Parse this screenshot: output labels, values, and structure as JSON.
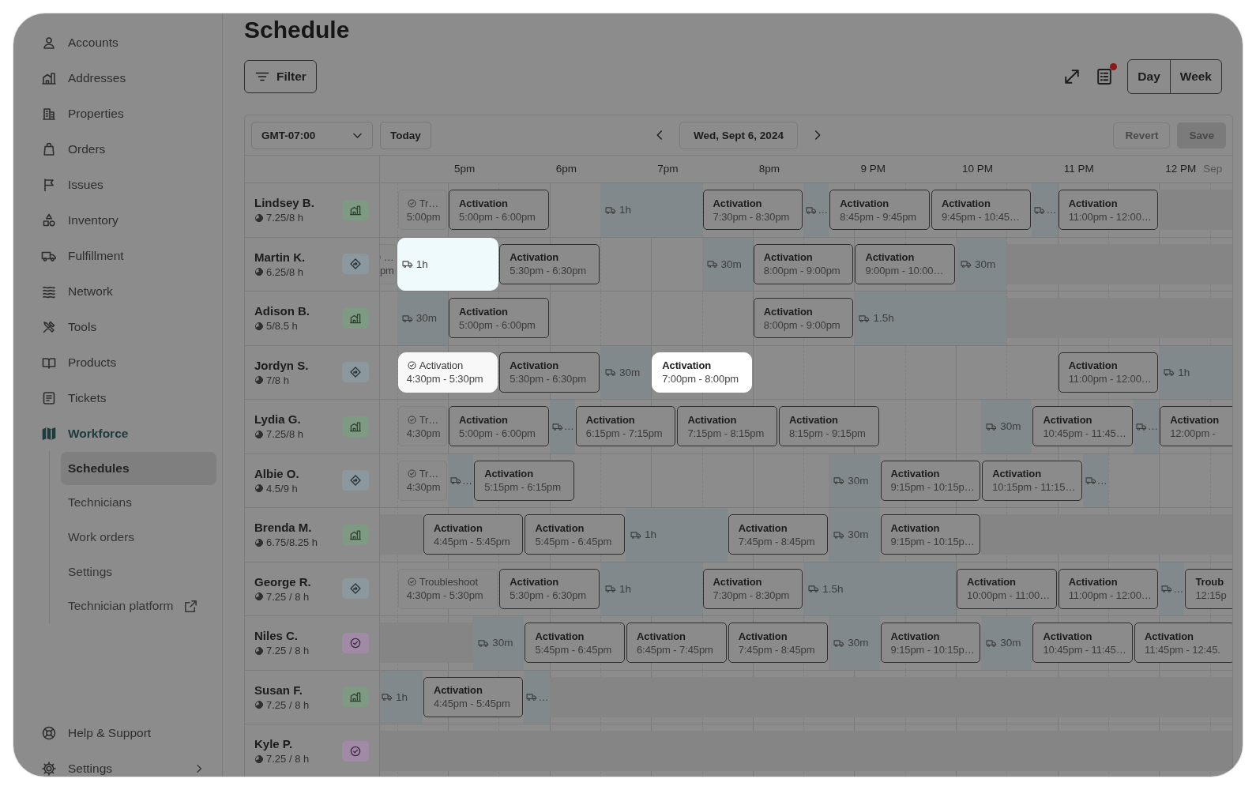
{
  "sidebar": {
    "items": [
      {
        "label": "Accounts",
        "selected": false
      },
      {
        "label": "Addresses",
        "selected": false
      },
      {
        "label": "Properties",
        "selected": false
      },
      {
        "label": "Orders",
        "selected": false
      },
      {
        "label": "Issues",
        "selected": false
      },
      {
        "label": "Inventory",
        "selected": false
      },
      {
        "label": "Fulfillment",
        "selected": false
      },
      {
        "label": "Network",
        "selected": false
      },
      {
        "label": "Tools",
        "selected": false
      },
      {
        "label": "Products",
        "selected": false
      },
      {
        "label": "Tickets",
        "selected": false
      },
      {
        "label": "Workforce",
        "selected": true,
        "expanded": true,
        "children": [
          {
            "label": "Schedules",
            "selected": true,
            "external": false
          },
          {
            "label": "Technicians",
            "selected": false,
            "external": false
          },
          {
            "label": "Work orders",
            "selected": false,
            "external": false
          },
          {
            "label": "Settings",
            "selected": false,
            "external": false
          },
          {
            "label": "Technician platform",
            "selected": false,
            "external": true
          }
        ]
      }
    ],
    "footer": [
      {
        "label": "Help & Support",
        "submenu": false
      },
      {
        "label": "Settings",
        "submenu": true
      }
    ]
  },
  "header": {
    "title": "Schedule",
    "filter": "Filter",
    "notification": true,
    "views": [
      {
        "label": "Day",
        "selected": false
      },
      {
        "label": "Week",
        "selected": false
      }
    ]
  },
  "calendar": {
    "timezone": "GMT-07:00",
    "today": "Today",
    "date": "Wed, Sept 6, 2024",
    "revert": {
      "label": "Revert",
      "disabled": true
    },
    "save": {
      "label": "Save",
      "disabled": true
    },
    "time_labels": [
      {
        "label": "5pm",
        "faded": false
      },
      {
        "label": "6pm",
        "faded": false
      },
      {
        "label": "7pm",
        "faded": false
      },
      {
        "label": "8pm",
        "faded": false
      },
      {
        "label": "9 PM",
        "faded": false
      },
      {
        "label": "10 PM",
        "faded": false
      },
      {
        "label": "11 PM",
        "faded": false
      },
      {
        "label": "12 PM",
        "faded": false
      },
      {
        "label": "Sep",
        "faded": true
      }
    ],
    "rows": [
      {
        "name": "Lindsey B.",
        "hours": "7.25/8 h",
        "kind": "building",
        "items": [
          {
            "kind": "done",
            "title": "Tr…",
            "time": "5:00pm",
            "highlighted": false
          },
          {
            "kind": "job",
            "title": "Activation",
            "time": "5:00pm - 6:00pm",
            "highlighted": false
          },
          {
            "kind": "travel",
            "label": "1h",
            "highlighted": false
          },
          {
            "kind": "job",
            "title": "Activation",
            "time": "7:30pm - 8:30pm",
            "highlighted": false
          },
          {
            "kind": "travel",
            "label": "…",
            "highlighted": false
          },
          {
            "kind": "job",
            "title": "Activation",
            "time": "8:45pm - 9:45pm",
            "highlighted": false
          },
          {
            "kind": "job",
            "title": "Activation",
            "time": "9:45pm - 10:45…",
            "highlighted": false
          },
          {
            "kind": "travel",
            "label": "…",
            "highlighted": false
          },
          {
            "kind": "job",
            "title": "Activation",
            "time": "11:00pm - 12:00…",
            "highlighted": false
          },
          {
            "kind": "unavailable"
          }
        ]
      },
      {
        "name": "Martin K.",
        "hours": "6.25/8 h",
        "kind": "route",
        "items": [
          {
            "kind": "done",
            "title": "…",
            "time": "pm",
            "highlighted": false
          },
          {
            "kind": "travel",
            "label": "1h",
            "highlighted": true
          },
          {
            "kind": "job",
            "title": "Activation",
            "time": "5:30pm - 6:30pm",
            "highlighted": false
          },
          {
            "kind": "travel",
            "label": "30m",
            "highlighted": false
          },
          {
            "kind": "job",
            "title": "Activation",
            "time": "8:00pm - 9:00pm",
            "highlighted": false
          },
          {
            "kind": "job",
            "title": "Activation",
            "time": "9:00pm - 10:00…",
            "highlighted": false
          },
          {
            "kind": "travel",
            "label": "30m",
            "highlighted": false
          },
          {
            "kind": "unavailable"
          }
        ]
      },
      {
        "name": "Adison B.",
        "hours": "5/8.5 h",
        "kind": "building",
        "items": [
          {
            "kind": "travel",
            "label": "30m",
            "highlighted": false
          },
          {
            "kind": "job",
            "title": "Activation",
            "time": "5:00pm - 6:00pm",
            "highlighted": false
          },
          {
            "kind": "job",
            "title": "Activation",
            "time": "8:00pm - 9:00pm",
            "highlighted": false
          },
          {
            "kind": "travel",
            "label": "1.5h",
            "highlighted": false
          },
          {
            "kind": "unavailable"
          }
        ]
      },
      {
        "name": "Jordyn S.",
        "hours": "7/8 h",
        "kind": "route",
        "items": [
          {
            "kind": "done",
            "title": "Activation",
            "time": "4:30pm - 5:30pm",
            "highlighted": true
          },
          {
            "kind": "job",
            "title": "Activation",
            "time": "5:30pm - 6:30pm",
            "highlighted": false
          },
          {
            "kind": "travel",
            "label": "30m",
            "highlighted": false
          },
          {
            "kind": "job",
            "title": "Activation",
            "time": "7:00pm - 8:00pm",
            "highlighted": true
          },
          {
            "kind": "job",
            "title": "Activation",
            "time": "11:00pm - 12:00…",
            "highlighted": false
          },
          {
            "kind": "travel",
            "label": "1h",
            "highlighted": false
          }
        ]
      },
      {
        "name": "Lydia G.",
        "hours": "7.25/8 h",
        "kind": "building",
        "items": [
          {
            "kind": "done",
            "title": "Tr…",
            "time": "4:30pm",
            "highlighted": false
          },
          {
            "kind": "job",
            "title": "Activation",
            "time": "5:00pm - 6:00pm",
            "highlighted": false
          },
          {
            "kind": "travel",
            "label": "…",
            "highlighted": false
          },
          {
            "kind": "job",
            "title": "Activation",
            "time": "6:15pm - 7:15pm",
            "highlighted": false
          },
          {
            "kind": "job",
            "title": "Activation",
            "time": "7:15pm - 8:15pm",
            "highlighted": false
          },
          {
            "kind": "job",
            "title": "Activation",
            "time": "8:15pm - 9:15pm",
            "highlighted": false
          },
          {
            "kind": "travel",
            "label": "30m",
            "highlighted": false
          },
          {
            "kind": "job",
            "title": "Activation",
            "time": "10:45pm - 11:45…",
            "highlighted": false
          },
          {
            "kind": "travel",
            "label": "…",
            "highlighted": false
          },
          {
            "kind": "job",
            "title": "Activation",
            "time": "12:00pm -",
            "highlighted": false
          }
        ]
      },
      {
        "name": "Albie O.",
        "hours": "4.5/9 h",
        "kind": "route",
        "items": [
          {
            "kind": "done",
            "title": "Tr…",
            "time": "4:30pm",
            "highlighted": false
          },
          {
            "kind": "travel",
            "label": "…",
            "highlighted": false
          },
          {
            "kind": "job",
            "title": "Activation",
            "time": "5:15pm - 6:15pm",
            "highlighted": false
          },
          {
            "kind": "travel",
            "label": "30m",
            "highlighted": false
          },
          {
            "kind": "job",
            "title": "Activation",
            "time": "9:15pm - 10:15p…",
            "highlighted": false
          },
          {
            "kind": "job",
            "title": "Activation",
            "time": "10:15pm - 11:15…",
            "highlighted": false
          },
          {
            "kind": "travel",
            "label": "…",
            "highlighted": false
          }
        ]
      },
      {
        "name": "Brenda M.",
        "hours": "6.75/8.25 h",
        "kind": "building",
        "items": [
          {
            "kind": "unavailable"
          },
          {
            "kind": "job",
            "title": "Activation",
            "time": "4:45pm - 5:45pm",
            "highlighted": false
          },
          {
            "kind": "job",
            "title": "Activation",
            "time": "5:45pm - 6:45pm",
            "highlighted": false
          },
          {
            "kind": "travel",
            "label": "1h",
            "highlighted": false
          },
          {
            "kind": "job",
            "title": "Activation",
            "time": "7:45pm - 8:45pm",
            "highlighted": false
          },
          {
            "kind": "travel",
            "label": "30m",
            "highlighted": false
          },
          {
            "kind": "job",
            "title": "Activation",
            "time": "9:15pm - 10:15p…",
            "highlighted": false
          },
          {
            "kind": "unavailable"
          }
        ]
      },
      {
        "name": "George R.",
        "hours": "7.25 / 8 h",
        "kind": "route",
        "items": [
          {
            "kind": "done",
            "title": "Troubleshoot",
            "time": "4:30pm - 5:30pm",
            "highlighted": false
          },
          {
            "kind": "job",
            "title": "Activation",
            "time": "5:30pm - 6:30pm",
            "highlighted": false
          },
          {
            "kind": "travel",
            "label": "1h",
            "highlighted": false
          },
          {
            "kind": "job",
            "title": "Activation",
            "time": "7:30pm - 8:30pm",
            "highlighted": false
          },
          {
            "kind": "travel",
            "label": "1.5h",
            "highlighted": false
          },
          {
            "kind": "job",
            "title": "Activation",
            "time": "10:00pm - 11:00…",
            "highlighted": false
          },
          {
            "kind": "job",
            "title": "Activation",
            "time": "11:00pm - 12:00…",
            "highlighted": false
          },
          {
            "kind": "travel",
            "label": "…",
            "highlighted": false
          },
          {
            "kind": "job",
            "title": "Troub",
            "time": "12:15p",
            "highlighted": false
          }
        ]
      },
      {
        "name": "Niles C.",
        "hours": "7.25 / 8 h",
        "kind": "check",
        "items": [
          {
            "kind": "unavailable"
          },
          {
            "kind": "travel",
            "label": "30m",
            "highlighted": false
          },
          {
            "kind": "job",
            "title": "Activation",
            "time": "5:45pm - 6:45pm",
            "highlighted": false
          },
          {
            "kind": "job",
            "title": "Activation",
            "time": "6:45pm - 7:45pm",
            "highlighted": false
          },
          {
            "kind": "job",
            "title": "Activation",
            "time": "7:45pm - 8:45pm",
            "highlighted": false
          },
          {
            "kind": "travel",
            "label": "30m",
            "highlighted": false
          },
          {
            "kind": "job",
            "title": "Activation",
            "time": "9:15pm - 10:15p…",
            "highlighted": false
          },
          {
            "kind": "travel",
            "label": "30m",
            "highlighted": false
          },
          {
            "kind": "job",
            "title": "Activation",
            "time": "10:45pm - 11:45…",
            "highlighted": false
          },
          {
            "kind": "job",
            "title": "Activation",
            "time": "11:45pm - 12:45.",
            "highlighted": false
          }
        ]
      },
      {
        "name": "Susan F.",
        "hours": "7.25 / 8 h",
        "kind": "building",
        "items": [
          {
            "kind": "travel",
            "label": "1h",
            "highlighted": false
          },
          {
            "kind": "job",
            "title": "Activation",
            "time": "4:45pm - 5:45pm",
            "highlighted": false
          },
          {
            "kind": "travel",
            "label": "…",
            "highlighted": false
          },
          {
            "kind": "unavailable"
          }
        ]
      },
      {
        "name": "Kyle P.",
        "hours": "7.25 / 8 h",
        "kind": "check",
        "items": [
          {
            "kind": "unavailable"
          }
        ]
      }
    ]
  }
}
